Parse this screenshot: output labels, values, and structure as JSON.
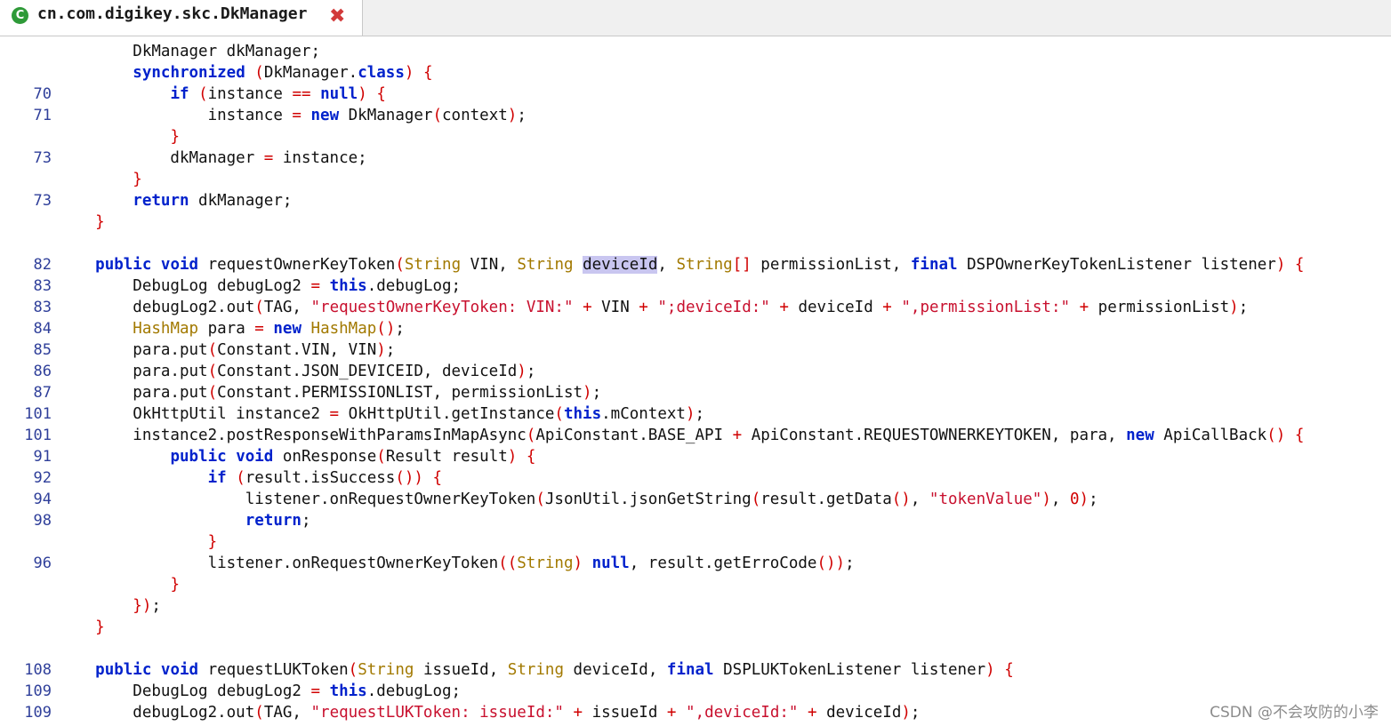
{
  "tab": {
    "title": "cn.com.digikey.skc.DkManager",
    "icon": "java-class-icon",
    "close_icon": "close-icon"
  },
  "watermark": "CSDN @不会攻防的小李",
  "colors": {
    "keyword": "#0022cc",
    "string": "#c8102e",
    "type": "#a27900",
    "punct": "#d00000",
    "line_number": "#2f3f9a",
    "selection": "#c9c6f0"
  },
  "lines": [
    {
      "n": "",
      "t": [
        [
          "",
          "        DkManager dkManager;"
        ]
      ]
    },
    {
      "n": "",
      "t": [
        [
          "",
          "        "
        ],
        [
          "kw",
          "synchronized"
        ],
        [
          "",
          " "
        ],
        [
          "pu",
          "("
        ],
        [
          "",
          "DkManager."
        ],
        [
          "kw",
          "class"
        ],
        [
          "pu",
          ")"
        ],
        [
          "",
          " "
        ],
        [
          "pu",
          "{"
        ]
      ]
    },
    {
      "n": "70",
      "t": [
        [
          "",
          "            "
        ],
        [
          "kw",
          "if"
        ],
        [
          "",
          " "
        ],
        [
          "pu",
          "("
        ],
        [
          "",
          "instance "
        ],
        [
          "pu",
          "=="
        ],
        [
          "",
          " "
        ],
        [
          "kw",
          "null"
        ],
        [
          "pu",
          ")"
        ],
        [
          "",
          " "
        ],
        [
          "pu",
          "{"
        ]
      ]
    },
    {
      "n": "71",
      "t": [
        [
          "",
          "                instance "
        ],
        [
          "pu",
          "="
        ],
        [
          "",
          " "
        ],
        [
          "kw",
          "new"
        ],
        [
          "",
          " DkManager"
        ],
        [
          "pu",
          "("
        ],
        [
          "",
          "context"
        ],
        [
          "pu",
          ")"
        ],
        [
          "",
          ";"
        ]
      ]
    },
    {
      "n": "",
      "t": [
        [
          "",
          "            "
        ],
        [
          "pu",
          "}"
        ]
      ]
    },
    {
      "n": "73",
      "t": [
        [
          "",
          "            dkManager "
        ],
        [
          "pu",
          "="
        ],
        [
          "",
          " instance;"
        ]
      ]
    },
    {
      "n": "",
      "t": [
        [
          "",
          "        "
        ],
        [
          "pu",
          "}"
        ]
      ]
    },
    {
      "n": "73",
      "t": [
        [
          "",
          "        "
        ],
        [
          "kw",
          "return"
        ],
        [
          "",
          " dkManager;"
        ]
      ]
    },
    {
      "n": "",
      "t": [
        [
          "",
          "    "
        ],
        [
          "pu",
          "}"
        ]
      ]
    },
    {
      "n": "",
      "t": []
    },
    {
      "n": "82",
      "t": [
        [
          "",
          "    "
        ],
        [
          "kw",
          "public"
        ],
        [
          "",
          " "
        ],
        [
          "kw",
          "void"
        ],
        [
          "",
          " requestOwnerKeyToken"
        ],
        [
          "pu",
          "("
        ],
        [
          "ty",
          "String"
        ],
        [
          "",
          " VIN, "
        ],
        [
          "ty",
          "String"
        ],
        [
          "",
          " "
        ],
        [
          "hl",
          "deviceId"
        ],
        [
          "",
          ", "
        ],
        [
          "ty",
          "String"
        ],
        [
          "pu",
          "[]"
        ],
        [
          "",
          " permissionList, "
        ],
        [
          "kw",
          "final"
        ],
        [
          "",
          " DSPOwnerKeyTokenListener listener"
        ],
        [
          "pu",
          ")"
        ],
        [
          "",
          " "
        ],
        [
          "pu",
          "{"
        ]
      ]
    },
    {
      "n": "83",
      "t": [
        [
          "",
          "        DebugLog debugLog2 "
        ],
        [
          "pu",
          "="
        ],
        [
          "",
          " "
        ],
        [
          "kw",
          "this"
        ],
        [
          "",
          ".debugLog;"
        ]
      ]
    },
    {
      "n": "83",
      "t": [
        [
          "",
          "        debugLog2.out"
        ],
        [
          "pu",
          "("
        ],
        [
          "",
          "TAG, "
        ],
        [
          "str",
          "\"requestOwnerKeyToken: VIN:\""
        ],
        [
          "",
          " "
        ],
        [
          "pu",
          "+"
        ],
        [
          "",
          " VIN "
        ],
        [
          "pu",
          "+"
        ],
        [
          "",
          " "
        ],
        [
          "str",
          "\";deviceId:\""
        ],
        [
          "",
          " "
        ],
        [
          "pu",
          "+"
        ],
        [
          "",
          " deviceId "
        ],
        [
          "pu",
          "+"
        ],
        [
          "",
          " "
        ],
        [
          "str",
          "\",permissionList:\""
        ],
        [
          "",
          " "
        ],
        [
          "pu",
          "+"
        ],
        [
          "",
          " permissionList"
        ],
        [
          "pu",
          ")"
        ],
        [
          "",
          ";"
        ]
      ]
    },
    {
      "n": "84",
      "t": [
        [
          "",
          "        "
        ],
        [
          "ty",
          "HashMap"
        ],
        [
          "",
          " para "
        ],
        [
          "pu",
          "="
        ],
        [
          "",
          " "
        ],
        [
          "kw",
          "new"
        ],
        [
          "",
          " "
        ],
        [
          "ty",
          "HashMap"
        ],
        [
          "pu",
          "()"
        ],
        [
          "",
          ";"
        ]
      ]
    },
    {
      "n": "85",
      "t": [
        [
          "",
          "        para.put"
        ],
        [
          "pu",
          "("
        ],
        [
          "",
          "Constant.VIN, VIN"
        ],
        [
          "pu",
          ")"
        ],
        [
          "",
          ";"
        ]
      ]
    },
    {
      "n": "86",
      "t": [
        [
          "",
          "        para.put"
        ],
        [
          "pu",
          "("
        ],
        [
          "",
          "Constant.JSON_DEVICEID, deviceId"
        ],
        [
          "pu",
          ")"
        ],
        [
          "",
          ";"
        ]
      ]
    },
    {
      "n": "87",
      "t": [
        [
          "",
          "        para.put"
        ],
        [
          "pu",
          "("
        ],
        [
          "",
          "Constant.PERMISSIONLIST, permissionList"
        ],
        [
          "pu",
          ")"
        ],
        [
          "",
          ";"
        ]
      ]
    },
    {
      "n": "101",
      "t": [
        [
          "",
          "        OkHttpUtil instance2 "
        ],
        [
          "pu",
          "="
        ],
        [
          "",
          " OkHttpUtil.getInstance"
        ],
        [
          "pu",
          "("
        ],
        [
          "kw",
          "this"
        ],
        [
          "",
          ".mContext"
        ],
        [
          "pu",
          ")"
        ],
        [
          "",
          ";"
        ]
      ]
    },
    {
      "n": "101",
      "t": [
        [
          "",
          "        instance2.postResponseWithParamsInMapAsync"
        ],
        [
          "pu",
          "("
        ],
        [
          "",
          "ApiConstant.BASE_API "
        ],
        [
          "pu",
          "+"
        ],
        [
          "",
          " ApiConstant.REQUESTOWNERKEYTOKEN, para, "
        ],
        [
          "kw",
          "new"
        ],
        [
          "",
          " ApiCallBack"
        ],
        [
          "pu",
          "()"
        ],
        [
          "",
          " "
        ],
        [
          "pu",
          "{"
        ]
      ]
    },
    {
      "n": "91",
      "t": [
        [
          "",
          "            "
        ],
        [
          "kw",
          "public"
        ],
        [
          "",
          " "
        ],
        [
          "kw",
          "void"
        ],
        [
          "",
          " onResponse"
        ],
        [
          "pu",
          "("
        ],
        [
          "",
          "Result result"
        ],
        [
          "pu",
          ")"
        ],
        [
          "",
          " "
        ],
        [
          "pu",
          "{"
        ]
      ]
    },
    {
      "n": "92",
      "t": [
        [
          "",
          "                "
        ],
        [
          "kw",
          "if"
        ],
        [
          "",
          " "
        ],
        [
          "pu",
          "("
        ],
        [
          "",
          "result.isSuccess"
        ],
        [
          "pu",
          "())"
        ],
        [
          "",
          " "
        ],
        [
          "pu",
          "{"
        ]
      ]
    },
    {
      "n": "94",
      "t": [
        [
          "",
          "                    listener.onRequestOwnerKeyToken"
        ],
        [
          "pu",
          "("
        ],
        [
          "",
          "JsonUtil.jsonGetString"
        ],
        [
          "pu",
          "("
        ],
        [
          "",
          "result.getData"
        ],
        [
          "pu",
          "()"
        ],
        [
          "",
          ", "
        ],
        [
          "str",
          "\"tokenValue\""
        ],
        [
          "pu",
          ")"
        ],
        [
          "",
          ", "
        ],
        [
          "pu",
          "0"
        ],
        [
          "pu",
          ")"
        ],
        [
          "",
          ";"
        ]
      ]
    },
    {
      "n": "98",
      "t": [
        [
          "",
          "                    "
        ],
        [
          "kw",
          "return"
        ],
        [
          "",
          ";"
        ]
      ]
    },
    {
      "n": "",
      "t": [
        [
          "",
          "                "
        ],
        [
          "pu",
          "}"
        ]
      ]
    },
    {
      "n": "96",
      "t": [
        [
          "",
          "                listener.onRequestOwnerKeyToken"
        ],
        [
          "pu",
          "(("
        ],
        [
          "ty",
          "String"
        ],
        [
          "pu",
          ")"
        ],
        [
          "",
          " "
        ],
        [
          "kw",
          "null"
        ],
        [
          "",
          ", result.getErroCode"
        ],
        [
          "pu",
          "())"
        ],
        [
          "",
          ";"
        ]
      ]
    },
    {
      "n": "",
      "t": [
        [
          "",
          "            "
        ],
        [
          "pu",
          "}"
        ]
      ]
    },
    {
      "n": "",
      "t": [
        [
          "",
          "        "
        ],
        [
          "pu",
          "})"
        ],
        [
          "",
          ";"
        ]
      ]
    },
    {
      "n": "",
      "t": [
        [
          "",
          "    "
        ],
        [
          "pu",
          "}"
        ]
      ]
    },
    {
      "n": "",
      "t": []
    },
    {
      "n": "108",
      "t": [
        [
          "",
          "    "
        ],
        [
          "kw",
          "public"
        ],
        [
          "",
          " "
        ],
        [
          "kw",
          "void"
        ],
        [
          "",
          " requestLUKToken"
        ],
        [
          "pu",
          "("
        ],
        [
          "ty",
          "String"
        ],
        [
          "",
          " issueId, "
        ],
        [
          "ty",
          "String"
        ],
        [
          "",
          " deviceId, "
        ],
        [
          "kw",
          "final"
        ],
        [
          "",
          " DSPLUKTokenListener listener"
        ],
        [
          "pu",
          ")"
        ],
        [
          "",
          " "
        ],
        [
          "pu",
          "{"
        ]
      ]
    },
    {
      "n": "109",
      "t": [
        [
          "",
          "        DebugLog debugLog2 "
        ],
        [
          "pu",
          "="
        ],
        [
          "",
          " "
        ],
        [
          "kw",
          "this"
        ],
        [
          "",
          ".debugLog;"
        ]
      ]
    },
    {
      "n": "109",
      "t": [
        [
          "",
          "        debugLog2.out"
        ],
        [
          "pu",
          "("
        ],
        [
          "",
          "TAG, "
        ],
        [
          "str",
          "\"requestLUKToken: issueId:\""
        ],
        [
          "",
          " "
        ],
        [
          "pu",
          "+"
        ],
        [
          "",
          " issueId "
        ],
        [
          "pu",
          "+"
        ],
        [
          "",
          " "
        ],
        [
          "str",
          "\",deviceId:\""
        ],
        [
          "",
          " "
        ],
        [
          "pu",
          "+"
        ],
        [
          "",
          " deviceId"
        ],
        [
          "pu",
          ")"
        ],
        [
          "",
          ";"
        ]
      ]
    }
  ]
}
